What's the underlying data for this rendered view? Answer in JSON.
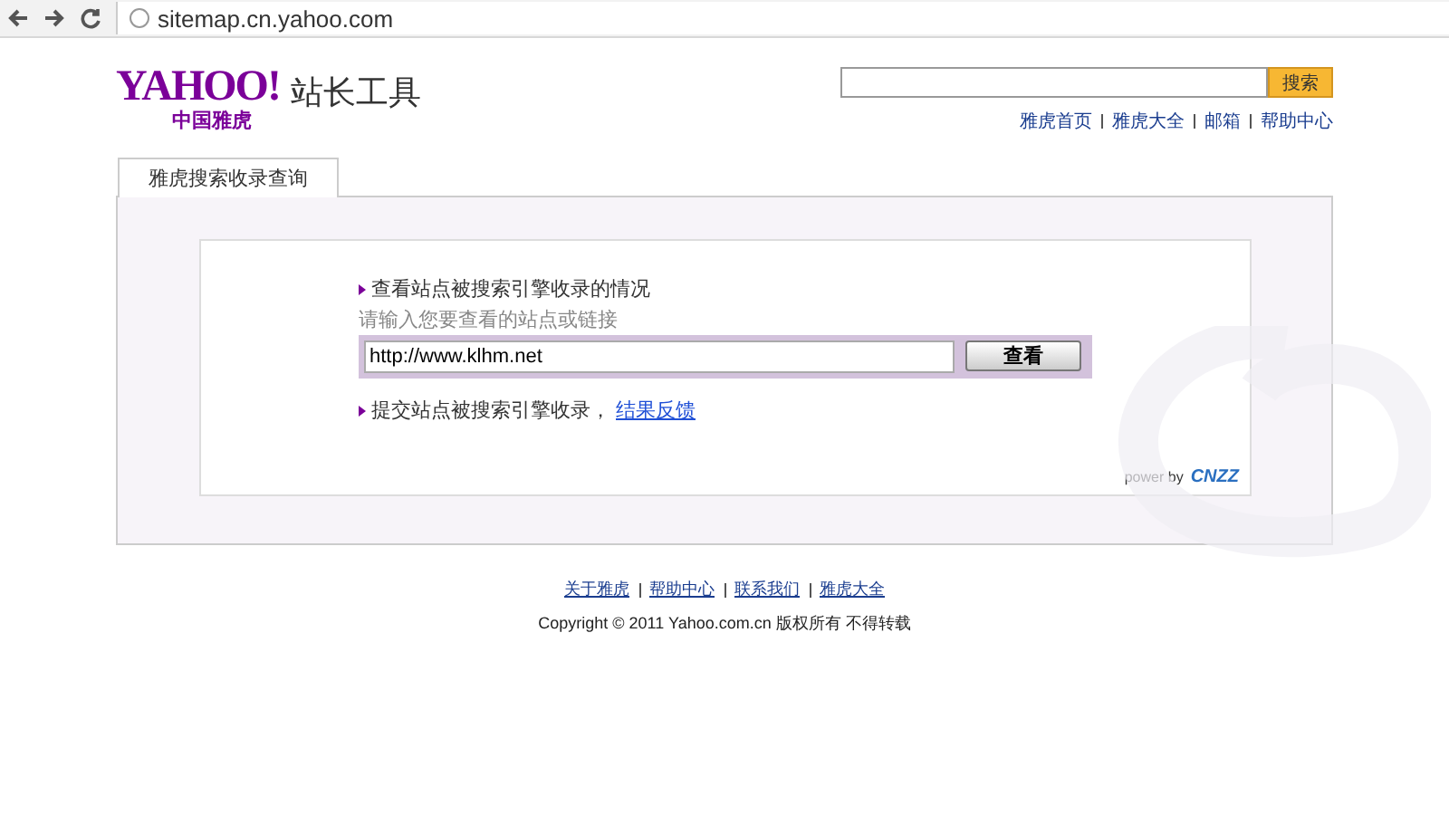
{
  "browser": {
    "url": "sitemap.cn.yahoo.com"
  },
  "header": {
    "logo": "YAHOO!",
    "logo_sub": "中国雅虎",
    "title": "站长工具",
    "search_button": "搜索",
    "links": [
      "雅虎首页",
      "雅虎大全",
      "邮箱",
      "帮助中心"
    ]
  },
  "tabs": [
    {
      "label": "雅虎搜索收录查询",
      "selected": true
    }
  ],
  "query": {
    "heading": "查看站点被搜索引擎收录的情况",
    "hint": "请输入您要查看的站点或链接",
    "value": "http://www.klhm.net",
    "button": "查看",
    "submit_text": "提交站点被搜索引擎收录，",
    "submit_link": "结果反馈"
  },
  "powered": {
    "label": "power by",
    "brand": "CNZZ"
  },
  "footer": {
    "links": [
      "关于雅虎",
      "帮助中心",
      "联系我们",
      "雅虎大全"
    ],
    "copyright": "Copyright © 2011 Yahoo.com.cn 版权所有 不得转载"
  }
}
